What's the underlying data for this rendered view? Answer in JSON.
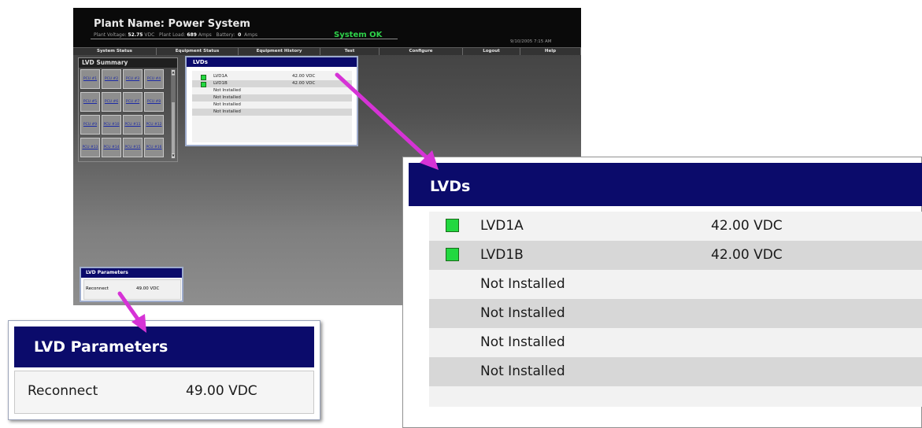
{
  "header": {
    "plant_name": "Plant Name: Power System",
    "plant_voltage_label": "Plant Voltage:",
    "plant_voltage_value": "52.75",
    "plant_voltage_unit": "VDC",
    "plant_load_label": "Plant Load:",
    "plant_load_value": "689",
    "plant_load_unit": "Amps",
    "battery_label": "Battery:",
    "battery_value": "0",
    "battery_unit": "Amps",
    "system_status": "System OK",
    "datetime": "9/10/2005 7:15 AM"
  },
  "nav": {
    "items": [
      "System Status",
      "Equipment Status",
      "Equipment History",
      "Test",
      "Configure",
      "Logout",
      "Help"
    ]
  },
  "lvd_summary": {
    "title": "LVD Summary",
    "pcu_labels": [
      "PCU #1",
      "PCU #2",
      "PCU #3",
      "PCU #4",
      "PCU #5",
      "PCU #6",
      "PCU #7",
      "PCU #8",
      "PCU #9",
      "PCU #10",
      "PCU #11",
      "PCU #12",
      "PCU #13",
      "PCU #14",
      "PCU #15",
      "PCU #16"
    ]
  },
  "lvds": {
    "title": "LVDs",
    "rows": [
      {
        "name": "LVD1A",
        "value": "42.00 VDC",
        "status_color": "#22d840"
      },
      {
        "name": "LVD1B",
        "value": "42.00 VDC",
        "status_color": "#22d840"
      },
      {
        "name": "Not Installed",
        "value": ""
      },
      {
        "name": "Not Installed",
        "value": ""
      },
      {
        "name": "Not Installed",
        "value": ""
      },
      {
        "name": "Not Installed",
        "value": ""
      }
    ]
  },
  "lvd_parameters": {
    "title": "LVD Parameters",
    "reconnect_label": "Reconnect",
    "reconnect_value": "49.00 VDC"
  },
  "colors": {
    "header_bg": "#0b0b6b",
    "status_ok": "#2ed24a",
    "indicator_green": "#22d840",
    "callout_arrow": "#d633d6"
  },
  "icons": [
    "scroll-up-arrow-icon",
    "scroll-down-arrow-icon",
    "status-square-icon",
    "callout-arrow-icon"
  ]
}
